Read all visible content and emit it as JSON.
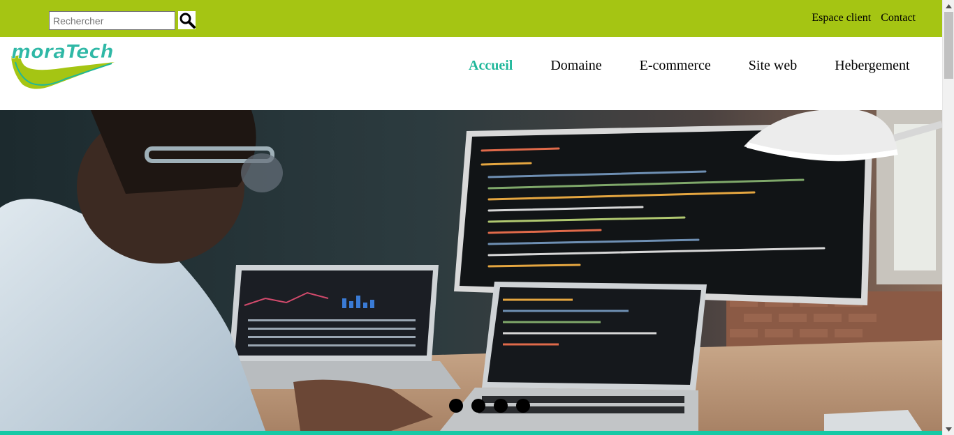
{
  "search": {
    "placeholder": "Rechercher",
    "button_icon": "search-icon"
  },
  "top_links": [
    {
      "label": "Espace client"
    },
    {
      "label": "Contact"
    }
  ],
  "logo": {
    "text": "moraTech"
  },
  "nav": [
    {
      "label": "Accueil",
      "active": true
    },
    {
      "label": "Domaine",
      "active": false
    },
    {
      "label": "E-commerce",
      "active": false
    },
    {
      "label": "Site web",
      "active": false
    },
    {
      "label": "Hebergement",
      "active": false
    }
  ],
  "slider": {
    "total_slides": 4
  },
  "colors": {
    "topbar": "#a5c513",
    "accent": "#1fb79a",
    "bottom_bar": "#16c9a5"
  }
}
